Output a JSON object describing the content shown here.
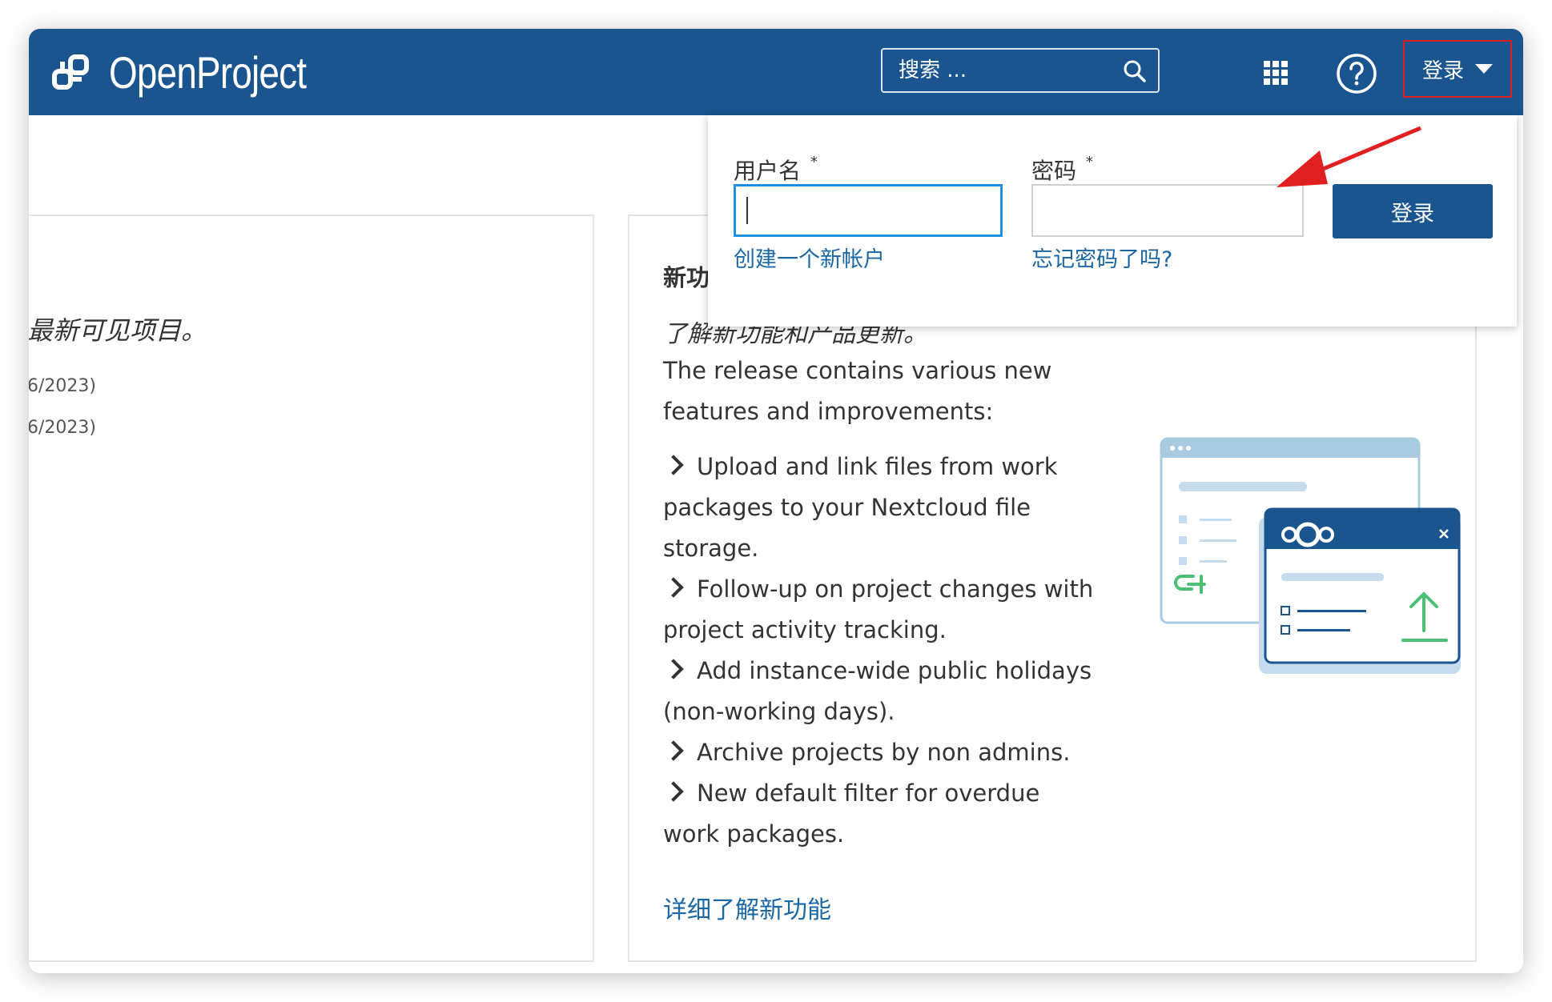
{
  "header": {
    "logo_text": "OpenProject",
    "search_placeholder": "搜索 ...",
    "login_label": "登录"
  },
  "left_panel": {
    "text": "最新可见项目。",
    "dates": [
      "6/2023)",
      "6/2023)"
    ]
  },
  "news": {
    "title": "新功",
    "subtitle": "了解新功能和产品更新。",
    "intro": "The release contains various new features and improvements:",
    "items": [
      "Upload and link files from work packages to your Nextcloud file storage.",
      "Follow-up on project changes with project activity tracking.",
      "Add instance-wide public holidays (non-working days).",
      "Archive projects by non admins.",
      "New default filter for overdue work packages."
    ],
    "link": "详细了解新功能"
  },
  "login_dropdown": {
    "username_label": "用户名",
    "password_label": "密码",
    "required_mark": "*",
    "username_value": "",
    "password_value": "",
    "create_account": "创建一个新帐户",
    "forgot_password": "忘记密码了吗?",
    "submit_label": "登录"
  },
  "colors": {
    "header": "#1a5590",
    "link": "#1a67a3",
    "focus": "#1f8fe0",
    "annotation": "#e02020"
  }
}
